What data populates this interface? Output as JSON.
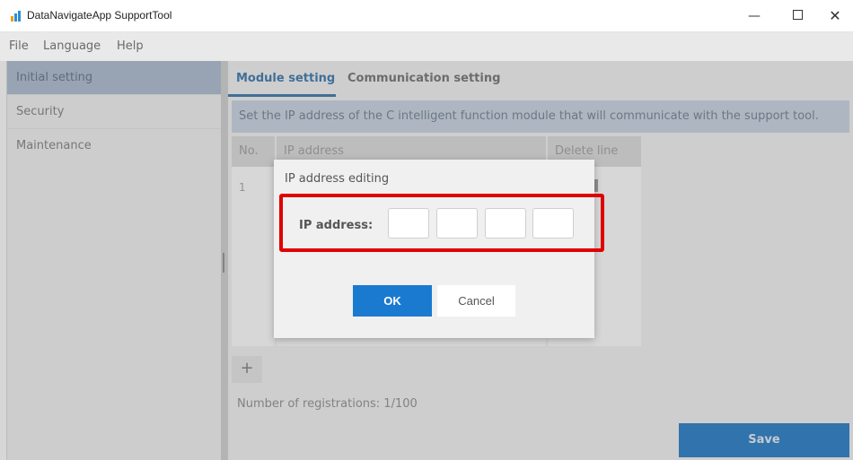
{
  "window": {
    "title": "DataNavigateApp SupportTool",
    "minimize_glyph": "—",
    "close_glyph": "✕"
  },
  "menu": {
    "items": [
      "File",
      "Language",
      "Help"
    ]
  },
  "sidebar": {
    "items": [
      {
        "label": "Initial setting",
        "active": true
      },
      {
        "label": "Security",
        "active": false
      },
      {
        "label": "Maintenance",
        "active": false
      }
    ]
  },
  "tabs": [
    {
      "label": "Module setting",
      "active": true
    },
    {
      "label": "Communication setting",
      "active": false
    }
  ],
  "banner": "Set the IP address of the C intelligent function module that will communicate with the support tool.",
  "table": {
    "headers": {
      "no": "No.",
      "ip": "IP address",
      "delete": "Delete line"
    },
    "rows": [
      {
        "no": "1"
      }
    ]
  },
  "add_button": "+",
  "registrations": "Number of registrations: 1/100",
  "save_label": "Save",
  "dialog": {
    "title": "IP address editing",
    "ip_label": "IP address:",
    "octets": [
      "",
      "",
      "",
      ""
    ],
    "ok_label": "OK",
    "cancel_label": "Cancel"
  },
  "colors": {
    "accent": "#1a75c4",
    "highlight": "#e00000",
    "sidebar_active": "#a8b9cf",
    "banner": "#c7d3e1"
  },
  "icons": {
    "app": "app-bars-icon",
    "minimize": "minimize-icon",
    "maximize": "maximize-icon",
    "close": "close-icon",
    "add": "plus-icon"
  }
}
